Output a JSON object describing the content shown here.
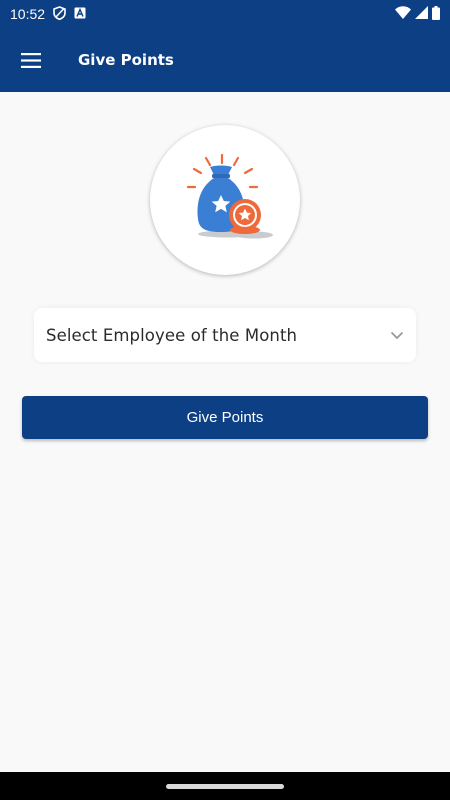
{
  "status_bar": {
    "time": "10:52",
    "icons": [
      "shield-icon",
      "app-a-icon",
      "wifi-icon",
      "signal-icon",
      "battery-icon"
    ]
  },
  "app_bar": {
    "title": "Give Points",
    "menu_icon": "hamburger-menu-icon"
  },
  "illustration": {
    "icon": "money-bag-with-star-coin-icon"
  },
  "employee_select": {
    "selected_text": "Select Employee of the Month",
    "icon": "chevron-down-icon"
  },
  "give_points_button": {
    "label": "Give Points"
  },
  "colors": {
    "primary": "#0d3f85",
    "background": "#f9f9f9",
    "bag_blue": "#3b7fd4",
    "accent_orange": "#ef6a3a"
  }
}
